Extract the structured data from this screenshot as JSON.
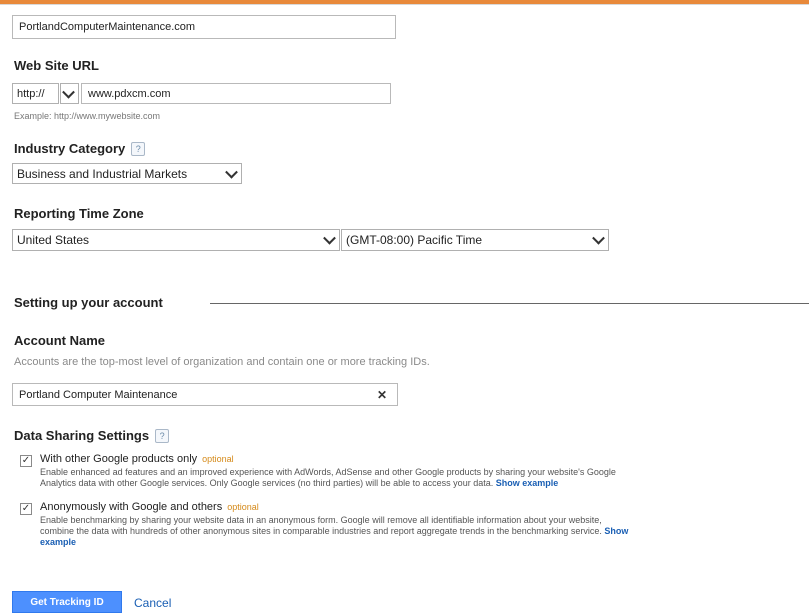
{
  "website_name_value": "PortlandComputerMaintenance.com",
  "website_url": {
    "label": "Web Site URL",
    "protocol": "http://",
    "value": "www.pdxcm.com",
    "example": "Example: http://www.mywebsite.com"
  },
  "industry": {
    "label": "Industry Category",
    "help": "?",
    "selected": "Business and Industrial Markets"
  },
  "timezone": {
    "label": "Reporting Time Zone",
    "country": "United States",
    "zone": "(GMT-08:00) Pacific Time"
  },
  "account_section": {
    "title": "Setting up your account",
    "name_label": "Account Name",
    "description": "Accounts are the top-most level of organization and contain one or more tracking IDs.",
    "name_value": "Portland Computer Maintenance",
    "clear": "✕"
  },
  "data_sharing": {
    "label": "Data Sharing Settings",
    "help": "?",
    "options": [
      {
        "title": "With other Google products only",
        "optional": "optional",
        "line1": "Enable enhanced ad features and an improved experience with AdWords, AdSense and other Google products by sharing your website's Google",
        "line2_prefix": "Analytics data with other Google services. Only Google services (no third parties) will be able to access your data.",
        "link": "Show example",
        "checked": "✓"
      },
      {
        "title": "Anonymously with Google and others",
        "optional": "optional",
        "line1": "Enable benchmarking by sharing your website data in an anonymous form. Google will remove all identifiable information about your website,",
        "line2_prefix": "combine the data with hundreds of other anonymous sites in comparable industries and report aggregate trends in the benchmarking service.",
        "link_part1": "Show",
        "link_part2": "example",
        "checked": "✓"
      }
    ]
  },
  "buttons": {
    "primary": "Get Tracking ID",
    "cancel": "Cancel"
  }
}
